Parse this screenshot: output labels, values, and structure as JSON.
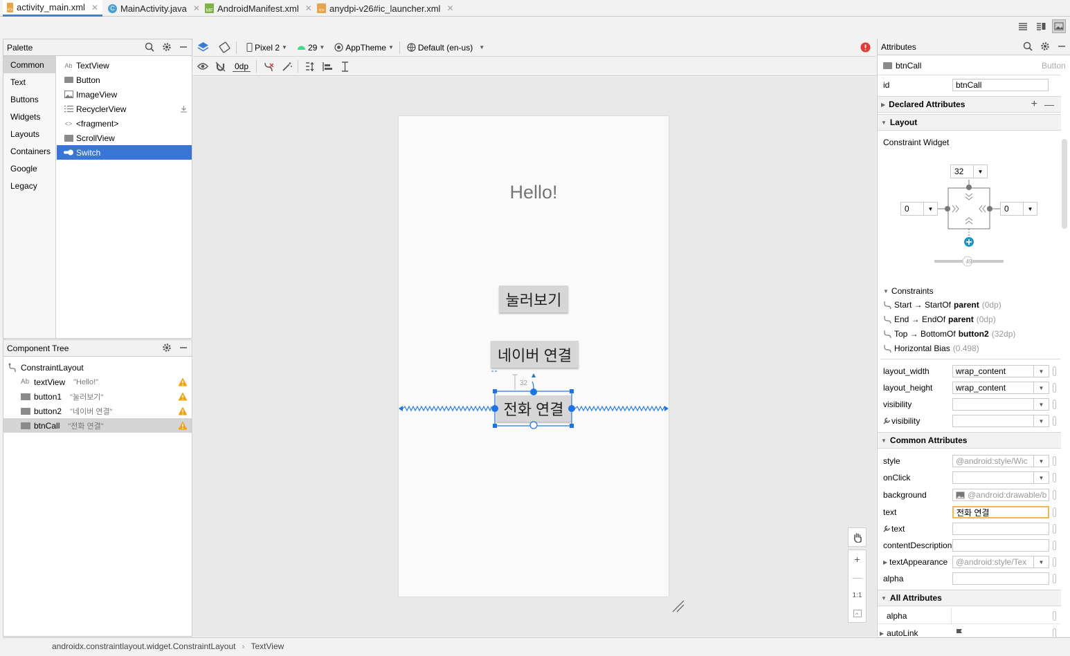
{
  "tabs": [
    {
      "label": "activity_main.xml",
      "active": true,
      "icon": "xml-layout-icon"
    },
    {
      "label": "MainActivity.java",
      "active": false,
      "icon": "java-class-icon"
    },
    {
      "label": "AndroidManifest.xml",
      "active": false,
      "icon": "manifest-icon"
    },
    {
      "label": "anydpi-v26#ic_launcher.xml",
      "active": false,
      "icon": "xml-icon"
    }
  ],
  "palette": {
    "title": "Palette",
    "categories": [
      "Common",
      "Text",
      "Buttons",
      "Widgets",
      "Layouts",
      "Containers",
      "Google",
      "Legacy"
    ],
    "selected_category": "Common",
    "items": [
      {
        "label": "TextView",
        "icon": "textview-icon"
      },
      {
        "label": "Button",
        "icon": "button-icon"
      },
      {
        "label": "ImageView",
        "icon": "imageview-icon"
      },
      {
        "label": "RecyclerView",
        "icon": "list-icon",
        "download": true
      },
      {
        "label": "<fragment>",
        "icon": "code-icon"
      },
      {
        "label": "ScrollView",
        "icon": "scrollview-icon"
      },
      {
        "label": "Switch",
        "icon": "switch-icon",
        "selected": true
      }
    ]
  },
  "component_tree": {
    "title": "Component Tree",
    "root": "ConstraintLayout",
    "items": [
      {
        "id": "textView",
        "hint": "\"Hello!\"",
        "warning": true
      },
      {
        "id": "button1",
        "hint": "\"눌러보기\"",
        "warning": true
      },
      {
        "id": "button2",
        "hint": "\"네이버 연결\"",
        "warning": true
      },
      {
        "id": "btnCall",
        "hint": "\"전화 연결\"",
        "warning": true,
        "selected": true
      }
    ]
  },
  "toolbar": {
    "device": "Pixel 2",
    "api": "29",
    "theme": "AppTheme",
    "locale": "Default (en-us)",
    "margin": "0dp"
  },
  "design": {
    "hello_text": "Hello!",
    "button1_text": "눌러보기",
    "button2_text": "네이버 연결",
    "btncall_text": "전화 연결",
    "margin_badge": "32"
  },
  "zoom": {
    "one_to_one": "1:1"
  },
  "attributes": {
    "title": "Attributes",
    "component_name": "btnCall",
    "component_type": "Button",
    "id_label": "id",
    "id_value": "btnCall",
    "declared_section": "Declared Attributes",
    "layout_section": "Layout",
    "constraint_widget": "Constraint Widget",
    "margin_top": "32",
    "margin_start": "0",
    "margin_end": "0",
    "bias": "49",
    "constraints_header": "Constraints",
    "constraints": [
      {
        "pre": "Start → StartOf ",
        "target": "parent",
        "dim": "(0dp)"
      },
      {
        "pre": "End → EndOf ",
        "target": "parent",
        "dim": "(0dp)"
      },
      {
        "pre": "Top → BottomOf ",
        "target": "button2",
        "dim": "(32dp)"
      },
      {
        "pre": "Horizontal Bias ",
        "target": "",
        "dim": "(0.498)"
      }
    ],
    "layout_width_label": "layout_width",
    "layout_width": "wrap_content",
    "layout_height_label": "layout_height",
    "layout_height": "wrap_content",
    "visibility_label": "visibility",
    "tools_visibility_label": "visibility",
    "common_section": "Common Attributes",
    "style_label": "style",
    "style_value": "@android:style/Wic",
    "onclick_label": "onClick",
    "background_label": "background",
    "background_value": "@android:drawable/b",
    "text_label": "text",
    "text_value": "전화 연결",
    "tools_text_label": "text",
    "content_desc_label": "contentDescription",
    "text_appearance_label": "textAppearance",
    "text_appearance_value": "@android:style/Tex",
    "alpha_label": "alpha",
    "all_section": "All Attributes",
    "all_alpha_label": "alpha",
    "autolink_label": "autoLink"
  },
  "statusbar": {
    "path1": "androidx.constraintlayout.widget.ConstraintLayout",
    "path2": "TextView"
  },
  "colors": {
    "accent": "#3875d7",
    "blueprint": "#1a73e8",
    "warning": "#f0a30a",
    "error": "#e53935"
  }
}
